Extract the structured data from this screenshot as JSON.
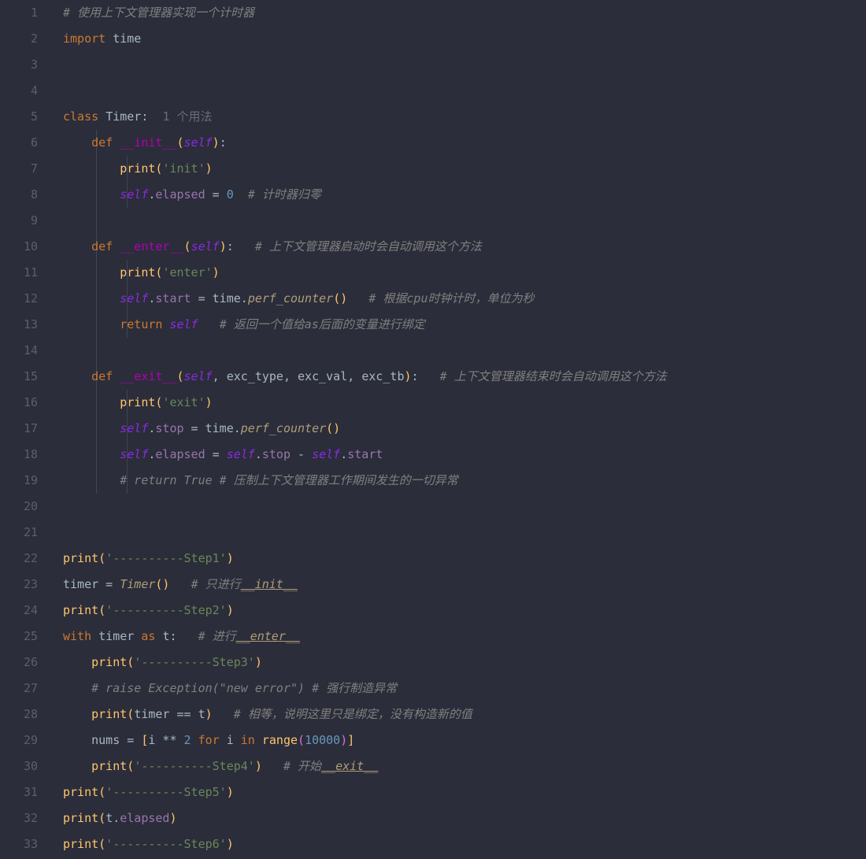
{
  "lines": [
    {
      "n": 1,
      "tokens": [
        [
          "cmt",
          "# 使用上下文管理器实现一个计时器"
        ]
      ]
    },
    {
      "n": 2,
      "tokens": [
        [
          "kw",
          "import"
        ],
        [
          "op",
          " "
        ],
        [
          "id",
          "time"
        ]
      ]
    },
    {
      "n": 3,
      "tokens": []
    },
    {
      "n": 4,
      "tokens": []
    },
    {
      "n": 5,
      "tokens": [
        [
          "kw",
          "class"
        ],
        [
          "op",
          " "
        ],
        [
          "cls",
          "Timer"
        ],
        [
          "op",
          ":  "
        ],
        [
          "hint",
          "1 个用法"
        ]
      ]
    },
    {
      "n": 6,
      "indent": 1,
      "tokens": [
        [
          "op",
          "    "
        ],
        [
          "kw",
          "def"
        ],
        [
          "op",
          " "
        ],
        [
          "dunder",
          "__init__"
        ],
        [
          "b1",
          "("
        ],
        [
          "self",
          "self"
        ],
        [
          "b1",
          ")"
        ],
        [
          "op",
          ":"
        ]
      ]
    },
    {
      "n": 7,
      "indent": 2,
      "tokens": [
        [
          "op",
          "        "
        ],
        [
          "fn",
          "print"
        ],
        [
          "b1",
          "("
        ],
        [
          "str",
          "'init'"
        ],
        [
          "b1",
          ")"
        ]
      ]
    },
    {
      "n": 8,
      "indent": 2,
      "tokens": [
        [
          "op",
          "        "
        ],
        [
          "self",
          "self"
        ],
        [
          "op",
          "."
        ],
        [
          "fld",
          "elapsed"
        ],
        [
          "op",
          " = "
        ],
        [
          "num",
          "0"
        ],
        [
          "op",
          "  "
        ],
        [
          "cmt",
          "# 计时器归零"
        ]
      ]
    },
    {
      "n": 9,
      "tokens": []
    },
    {
      "n": 10,
      "indent": 1,
      "tokens": [
        [
          "op",
          "    "
        ],
        [
          "kw",
          "def"
        ],
        [
          "op",
          " "
        ],
        [
          "dunder",
          "__enter__"
        ],
        [
          "b1",
          "("
        ],
        [
          "self",
          "self"
        ],
        [
          "b1",
          ")"
        ],
        [
          "op",
          ":   "
        ],
        [
          "cmt",
          "# 上下文管理器启动时会自动调用这个方法"
        ]
      ]
    },
    {
      "n": 11,
      "indent": 2,
      "tokens": [
        [
          "op",
          "        "
        ],
        [
          "fn",
          "print"
        ],
        [
          "b1",
          "("
        ],
        [
          "str",
          "'enter'"
        ],
        [
          "b1",
          ")"
        ]
      ]
    },
    {
      "n": 12,
      "indent": 2,
      "tokens": [
        [
          "op",
          "        "
        ],
        [
          "self",
          "self"
        ],
        [
          "op",
          "."
        ],
        [
          "fld",
          "start"
        ],
        [
          "op",
          " = "
        ],
        [
          "id",
          "time"
        ],
        [
          "op",
          "."
        ],
        [
          "mtd",
          "perf_counter"
        ],
        [
          "b1",
          "()"
        ],
        [
          "op",
          "   "
        ],
        [
          "cmt",
          "# 根据cpu时钟计时，单位为秒"
        ]
      ]
    },
    {
      "n": 13,
      "indent": 2,
      "tokens": [
        [
          "op",
          "        "
        ],
        [
          "kw",
          "return"
        ],
        [
          "op",
          " "
        ],
        [
          "self",
          "self"
        ],
        [
          "op",
          "   "
        ],
        [
          "cmt",
          "# 返回一个值给as后面的变量进行绑定"
        ]
      ]
    },
    {
      "n": 14,
      "tokens": []
    },
    {
      "n": 15,
      "indent": 1,
      "tokens": [
        [
          "op",
          "    "
        ],
        [
          "kw",
          "def"
        ],
        [
          "op",
          " "
        ],
        [
          "dunder",
          "__exit__"
        ],
        [
          "b1",
          "("
        ],
        [
          "self",
          "self"
        ],
        [
          "op",
          ", "
        ],
        [
          "id",
          "exc_type"
        ],
        [
          "op",
          ", "
        ],
        [
          "id",
          "exc_val"
        ],
        [
          "op",
          ", "
        ],
        [
          "id",
          "exc_tb"
        ],
        [
          "b1",
          ")"
        ],
        [
          "op",
          ":   "
        ],
        [
          "cmt",
          "# 上下文管理器结束时会自动调用这个方法"
        ]
      ]
    },
    {
      "n": 16,
      "indent": 2,
      "tokens": [
        [
          "op",
          "        "
        ],
        [
          "fn",
          "print"
        ],
        [
          "b1",
          "("
        ],
        [
          "str",
          "'exit'"
        ],
        [
          "b1",
          ")"
        ]
      ]
    },
    {
      "n": 17,
      "indent": 2,
      "tokens": [
        [
          "op",
          "        "
        ],
        [
          "self",
          "self"
        ],
        [
          "op",
          "."
        ],
        [
          "fld",
          "stop"
        ],
        [
          "op",
          " = "
        ],
        [
          "id",
          "time"
        ],
        [
          "op",
          "."
        ],
        [
          "mtd",
          "perf_counter"
        ],
        [
          "b1",
          "()"
        ]
      ]
    },
    {
      "n": 18,
      "indent": 2,
      "tokens": [
        [
          "op",
          "        "
        ],
        [
          "self",
          "self"
        ],
        [
          "op",
          "."
        ],
        [
          "fld",
          "elapsed"
        ],
        [
          "op",
          " = "
        ],
        [
          "self",
          "self"
        ],
        [
          "op",
          "."
        ],
        [
          "fld",
          "stop"
        ],
        [
          "op",
          " - "
        ],
        [
          "self",
          "self"
        ],
        [
          "op",
          "."
        ],
        [
          "fld",
          "start"
        ]
      ]
    },
    {
      "n": 19,
      "indent": 2,
      "tokens": [
        [
          "op",
          "        "
        ],
        [
          "cmt",
          "# return True # 压制上下文管理器工作期间发生的一切异常"
        ]
      ]
    },
    {
      "n": 20,
      "tokens": []
    },
    {
      "n": 21,
      "tokens": []
    },
    {
      "n": 22,
      "tokens": [
        [
          "fn",
          "print"
        ],
        [
          "b1",
          "("
        ],
        [
          "str",
          "'----------Step1'"
        ],
        [
          "b1",
          ")"
        ]
      ]
    },
    {
      "n": 23,
      "tokens": [
        [
          "id",
          "timer"
        ],
        [
          "op",
          " = "
        ],
        [
          "mtd",
          "Timer"
        ],
        [
          "b1",
          "()"
        ],
        [
          "op",
          "   "
        ],
        [
          "cmt",
          "# 只进行"
        ],
        [
          "dunder-cmt",
          "__init__"
        ]
      ]
    },
    {
      "n": 24,
      "tokens": [
        [
          "fn",
          "print"
        ],
        [
          "b1",
          "("
        ],
        [
          "str",
          "'----------Step2'"
        ],
        [
          "b1",
          ")"
        ]
      ]
    },
    {
      "n": 25,
      "tokens": [
        [
          "kw",
          "with"
        ],
        [
          "op",
          " "
        ],
        [
          "id",
          "timer"
        ],
        [
          "op",
          " "
        ],
        [
          "kw",
          "as"
        ],
        [
          "op",
          " "
        ],
        [
          "id",
          "t"
        ],
        [
          "op",
          ":   "
        ],
        [
          "cmt",
          "# 进行"
        ],
        [
          "dunder-cmt",
          "__enter__"
        ]
      ]
    },
    {
      "n": 26,
      "indent": 1,
      "tokens": [
        [
          "op",
          "    "
        ],
        [
          "fn",
          "print"
        ],
        [
          "b1",
          "("
        ],
        [
          "str",
          "'----------Step3'"
        ],
        [
          "b1",
          ")"
        ]
      ]
    },
    {
      "n": 27,
      "indent": 1,
      "tokens": [
        [
          "op",
          "    "
        ],
        [
          "cmt",
          "# raise Exception(\"new error\") # 强行制造异常"
        ]
      ]
    },
    {
      "n": 28,
      "indent": 1,
      "tokens": [
        [
          "op",
          "    "
        ],
        [
          "fn",
          "print"
        ],
        [
          "b1",
          "("
        ],
        [
          "id",
          "timer"
        ],
        [
          "op",
          " == "
        ],
        [
          "id",
          "t"
        ],
        [
          "b1",
          ")"
        ],
        [
          "op",
          "   "
        ],
        [
          "cmt",
          "# 相等，说明这里只是绑定，没有构造新的值"
        ]
      ]
    },
    {
      "n": 29,
      "indent": 1,
      "tokens": [
        [
          "op",
          "    "
        ],
        [
          "id",
          "nums"
        ],
        [
          "op",
          " = "
        ],
        [
          "b1",
          "["
        ],
        [
          "id",
          "i"
        ],
        [
          "op",
          " ** "
        ],
        [
          "num",
          "2"
        ],
        [
          "op",
          " "
        ],
        [
          "kw",
          "for"
        ],
        [
          "op",
          " "
        ],
        [
          "id",
          "i"
        ],
        [
          "op",
          " "
        ],
        [
          "kw",
          "in"
        ],
        [
          "op",
          " "
        ],
        [
          "fn",
          "range"
        ],
        [
          "b2",
          "("
        ],
        [
          "num",
          "10000"
        ],
        [
          "b2",
          ")"
        ],
        [
          "b1",
          "]"
        ]
      ]
    },
    {
      "n": 30,
      "indent": 1,
      "tokens": [
        [
          "op",
          "    "
        ],
        [
          "fn",
          "print"
        ],
        [
          "b1",
          "("
        ],
        [
          "str",
          "'----------Step4'"
        ],
        [
          "b1",
          ")"
        ],
        [
          "op",
          "   "
        ],
        [
          "cmt",
          "# 开始"
        ],
        [
          "dunder-cmt",
          "__exit__"
        ]
      ]
    },
    {
      "n": 31,
      "tokens": [
        [
          "fn",
          "print"
        ],
        [
          "b1",
          "("
        ],
        [
          "str",
          "'----------Step5'"
        ],
        [
          "b1",
          ")"
        ]
      ]
    },
    {
      "n": 32,
      "tokens": [
        [
          "fn",
          "print"
        ],
        [
          "b1",
          "("
        ],
        [
          "id",
          "t"
        ],
        [
          "op",
          "."
        ],
        [
          "fld",
          "elapsed"
        ],
        [
          "b1",
          ")"
        ]
      ]
    },
    {
      "n": 33,
      "tokens": [
        [
          "fn",
          "print"
        ],
        [
          "b1",
          "("
        ],
        [
          "str",
          "'----------Step6'"
        ],
        [
          "b1",
          ")"
        ]
      ]
    }
  ],
  "indent_bars": [
    {
      "col": 1,
      "from": 6,
      "to": 19
    },
    {
      "col": 2,
      "from": 7,
      "to": 8
    },
    {
      "col": 2,
      "from": 11,
      "to": 13
    },
    {
      "col": 2,
      "from": 16,
      "to": 19
    }
  ]
}
